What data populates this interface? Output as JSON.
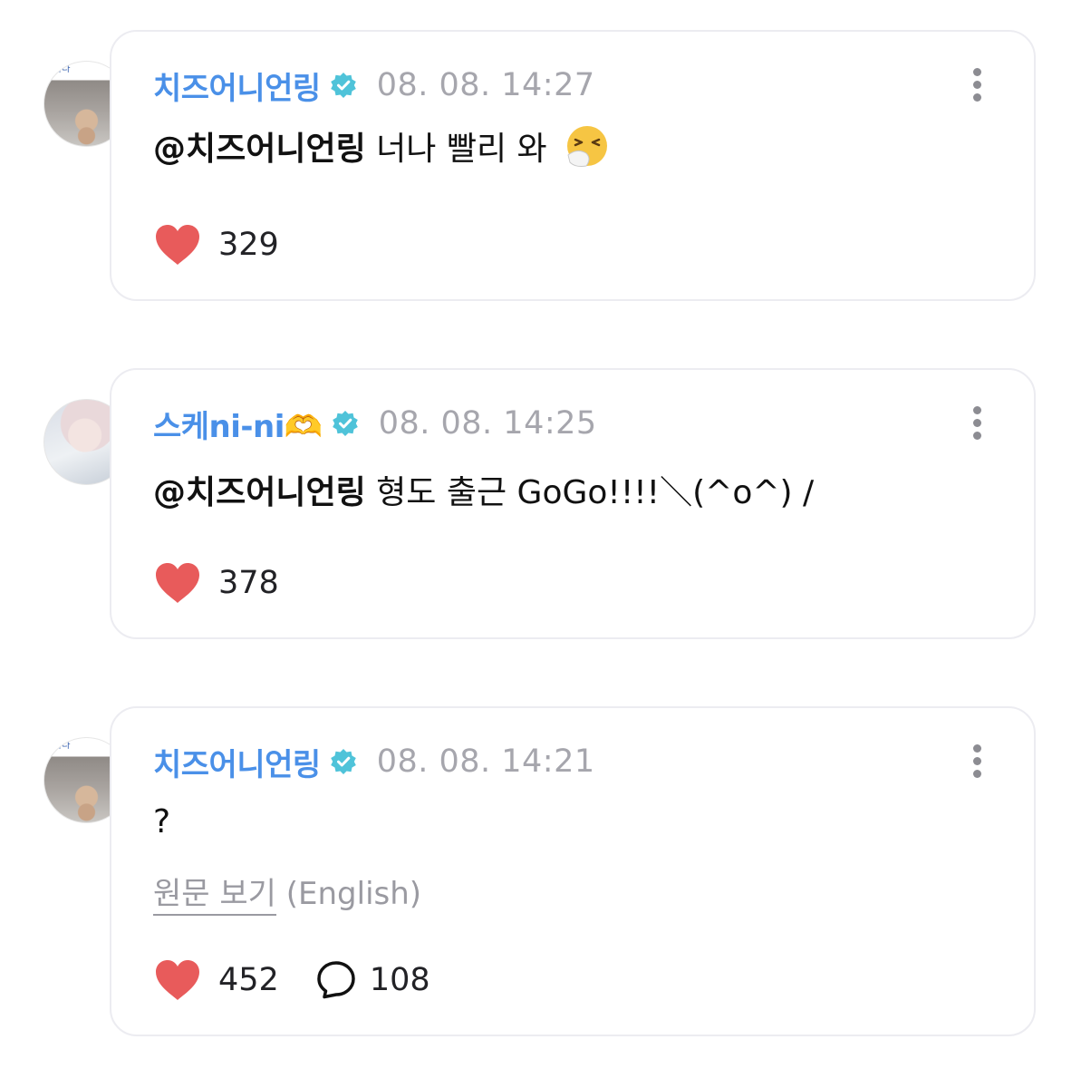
{
  "comments": [
    {
      "author": "치즈어니언링",
      "timestamp": "08. 08. 14:27",
      "mention": "@치즈어니언링",
      "text": " 너나 빨리 와",
      "emoji": "sneezing-face-icon",
      "likes": "329",
      "avatar_caption": "하다"
    },
    {
      "author": "스케ni-ni🫶",
      "timestamp": "08. 08. 14:25",
      "mention": "@치즈어니언링",
      "text": " 형도 출근 GoGo!!!!＼(^o^) /",
      "likes": "378"
    },
    {
      "author": "치즈어니언링",
      "timestamp": "08. 08. 14:21",
      "text": "?",
      "translate_link": "원문 보기",
      "translate_lang": " (English)",
      "likes": "452",
      "replies": "108",
      "avatar_caption": "하다"
    }
  ],
  "colors": {
    "author_name": "#4a90e8",
    "verified_badge": "#4fc3d9",
    "heart": "#e85b5b",
    "timestamp": "#a6a6ad",
    "card_border": "#ececf1"
  }
}
